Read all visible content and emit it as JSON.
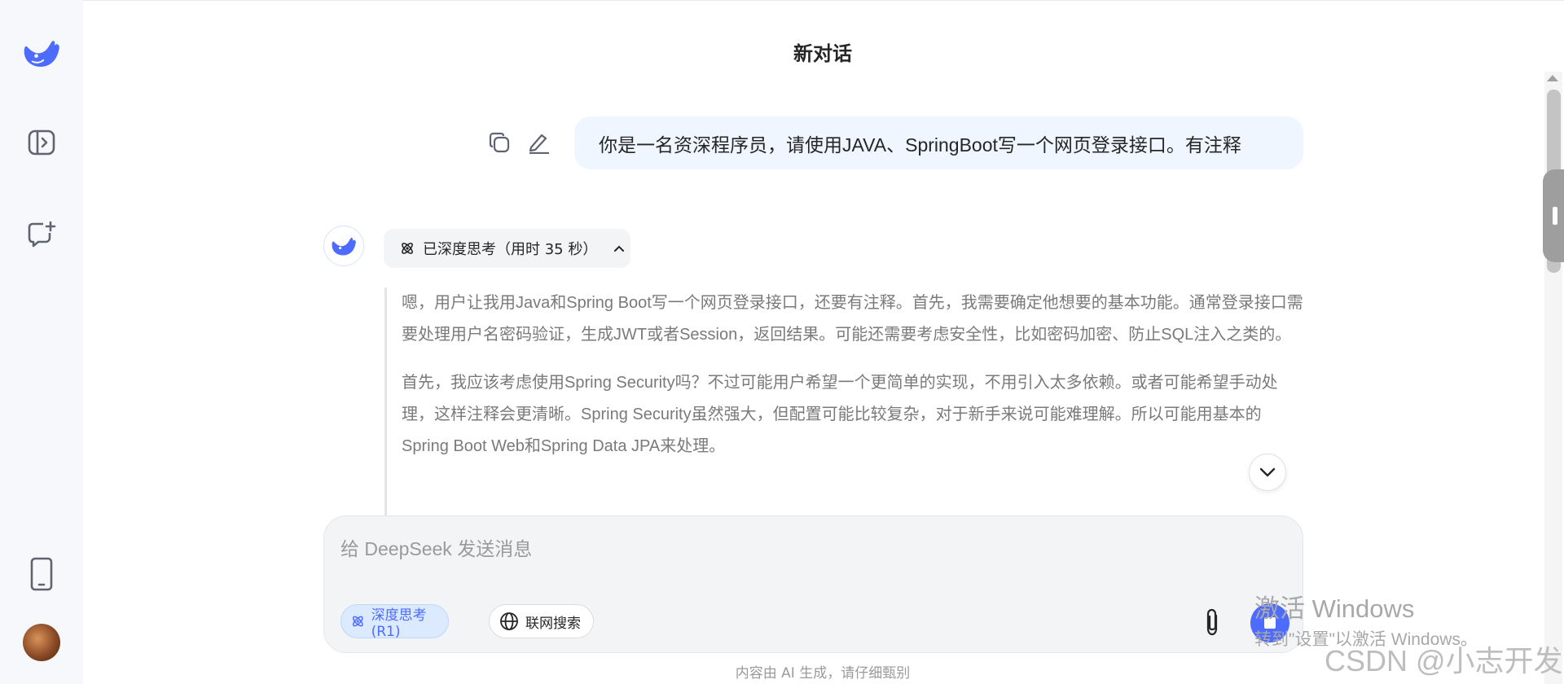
{
  "header": {
    "title": "新对话"
  },
  "user_message": {
    "text": "你是一名资深程序员，请使用JAVA、SpringBoot写一个网页登录接口。有注释"
  },
  "assistant": {
    "thinking_label": "已深度思考（用时 35 秒）",
    "thought_paragraphs": [
      "嗯，用户让我用Java和Spring Boot写一个网页登录接口，还要有注释。首先，我需要确定他想要的基本功能。通常登录接口需要处理用户名密码验证，生成JWT或者Session，返回结果。可能还需要考虑安全性，比如密码加密、防止SQL注入之类的。",
      "首先，我应该考虑使用Spring Security吗？不过可能用户希望一个更简单的实现，不用引入太多依赖。或者可能希望手动处理，这样注释会更清晰。Spring Security虽然强大，但配置可能比较复杂，对于新手来说可能难理解。所以可能用基本的Spring Boot Web和Spring Data JPA来处理。"
    ]
  },
  "composer": {
    "placeholder": "给 DeepSeek 发送消息",
    "deep_think_label": "深度思考 (R1)",
    "web_search_label": "联网搜索"
  },
  "disclaimer": "内容由 AI 生成，请仔细甄别",
  "watermark": {
    "title": "激活 Windows",
    "subtitle": "转到\"设置\"以激活 Windows。",
    "csdn": "CSDN @小志开发"
  },
  "colors": {
    "accent": "#4d6bfe",
    "bubble": "#eff6ff",
    "sidebar": "#f7f8fc"
  }
}
